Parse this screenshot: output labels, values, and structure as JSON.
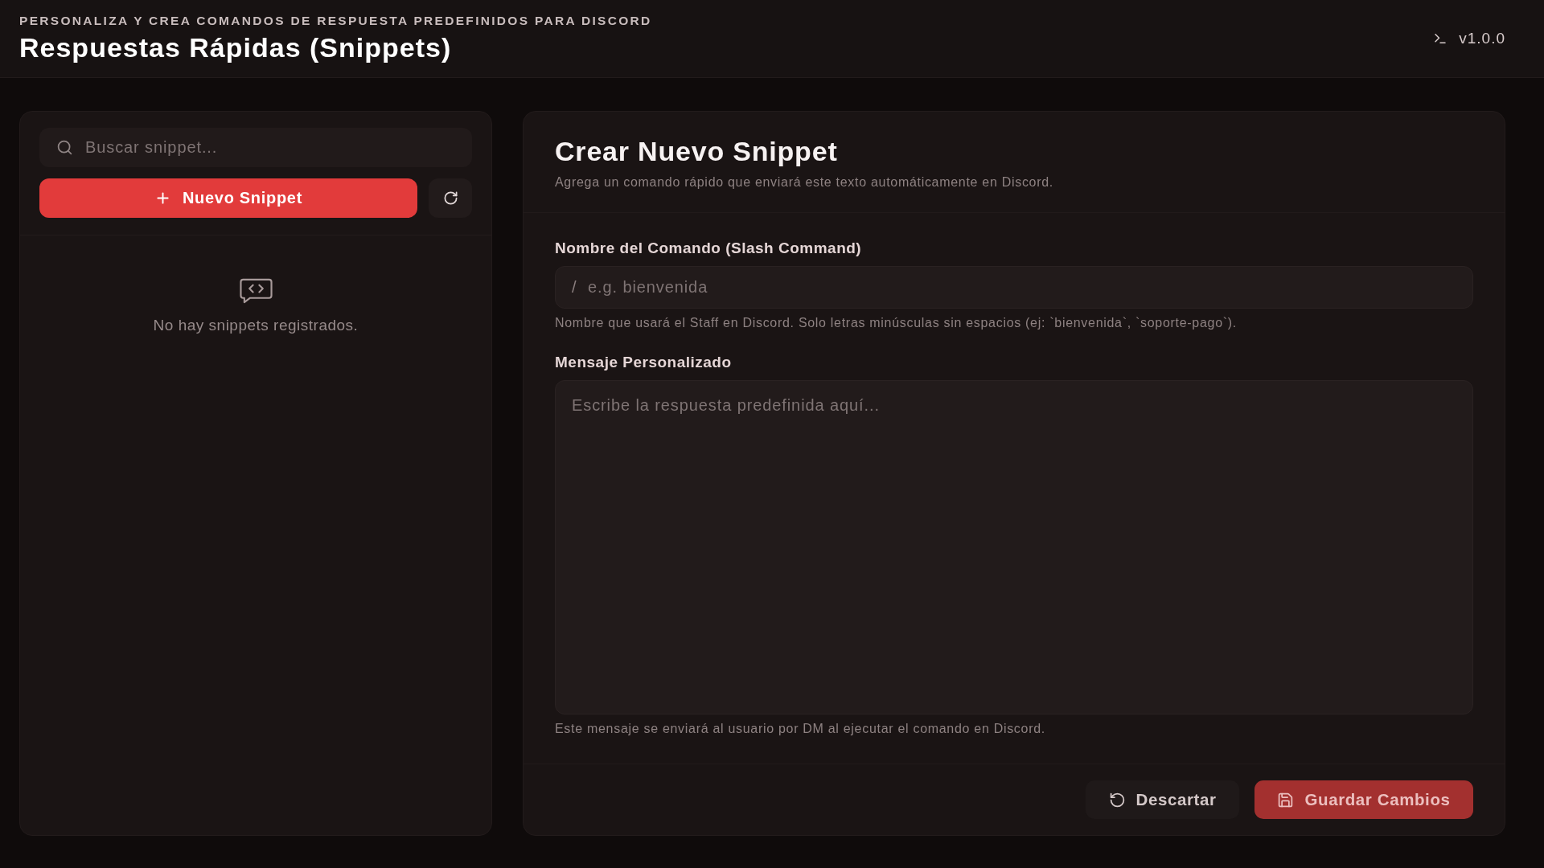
{
  "header": {
    "eyebrow": "PERSONALIZA Y CREA COMANDOS DE RESPUESTA PREDEFINIDOS PARA DISCORD",
    "title": "Respuestas Rápidas (Snippets)",
    "version": "v1.0.0"
  },
  "sidebar": {
    "search": {
      "placeholder": "Buscar snippet..."
    },
    "new_button": "Nuevo Snippet",
    "empty_message": "No hay snippets registrados."
  },
  "editor": {
    "title": "Crear Nuevo Snippet",
    "subtitle": "Agrega un comando rápido que enviará este texto automáticamente en Discord.",
    "fields": [
      {
        "kind": "input",
        "label": "Nombre del Comando (Slash Command)",
        "prefix": "/",
        "placeholder": "e.g. bienvenida",
        "hint": "Nombre que usará el Staff en Discord. Solo letras minúsculas sin espacios (ej: `bienvenida`, `soporte-pago`)."
      },
      {
        "kind": "textarea",
        "label": "Mensaje Personalizado",
        "placeholder": "Escribe la respuesta predefinida aquí...",
        "hint": "Este mensaje se enviará al usuario por DM al ejecutar el comando en Discord."
      }
    ],
    "buttons": [
      {
        "kind": "discard",
        "label": "Descartar",
        "disabled": false
      },
      {
        "kind": "save",
        "label": "Guardar Cambios",
        "disabled": true
      }
    ]
  }
}
